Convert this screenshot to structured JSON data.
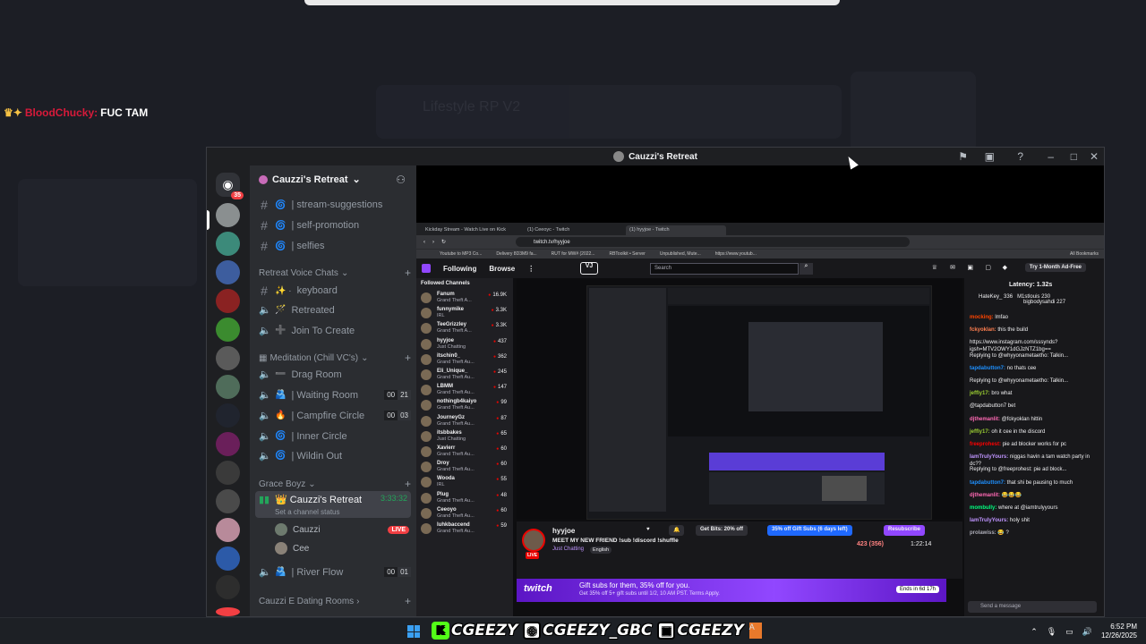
{
  "overlay": {
    "chat_user": "BloodChucky:",
    "chat_message": "FUC TAM"
  },
  "background": {
    "ghost_title": "Lifestyle RP V2"
  },
  "discord": {
    "window_title": "Cauzzi's Retreat",
    "server_badge": "35",
    "guild_name": "Cauzzi's Retreat",
    "text_channels": [
      "| stream-suggestions",
      "| self-promotion",
      "| selfies"
    ],
    "cat_retreat_voice": "Retreat Voice Chats",
    "voice_channels_1": [
      {
        "name": "keyboard",
        "prefix": "✨ ·"
      },
      {
        "name": "Retreated",
        "prefix": "🪄"
      },
      {
        "name": "Join To Create",
        "prefix": "➕"
      }
    ],
    "cat_meditation": "Meditation (Chill VC's)",
    "voice_channels_2": [
      {
        "name": "Drag Room",
        "prefix": "➖",
        "counts": []
      },
      {
        "name": "| Waiting Room",
        "prefix": "🫂",
        "counts": [
          "00",
          "21"
        ]
      },
      {
        "name": "| Campfire Circle",
        "prefix": "🔥",
        "counts": [
          "00",
          "03"
        ]
      },
      {
        "name": "| Inner Circle",
        "prefix": "🌀",
        "counts": []
      },
      {
        "name": "| Wildin Out",
        "prefix": "🌀",
        "counts": []
      }
    ],
    "cat_grace": "Grace Boyz",
    "active_channel": {
      "name": "Cauzzi's Retreat",
      "time": "3:33:32",
      "status": "Set a channel status"
    },
    "voice_users": [
      {
        "name": "Cauzzi",
        "live": "LIVE"
      },
      {
        "name": "Cee",
        "live": ""
      }
    ],
    "river_flow": {
      "name": "| River Flow",
      "counts": [
        "00",
        "01"
      ]
    },
    "cat_dating": "Cauzzi E Dating Rooms"
  },
  "browser": {
    "tabs": [
      "Kickday Stream - Watch Live on Kick",
      "(1) Ceeoyc - Twitch",
      "(1) hyyjoe - Twitch"
    ],
    "url": "twitch.tv/hyyjoe",
    "bookmarks": [
      "Youtube to MP3 Co...",
      "Delivery 8D3M9 fa...",
      "RUT for MW# (2022...",
      "RBToolkit • Server",
      "Unpublished, Mute...",
      "https://www.youtub..."
    ],
    "all_bookmarks": "All Bookmarks"
  },
  "twitch": {
    "nav_following": "Following",
    "nav_browse": "Browse",
    "search_placeholder": "Search",
    "turbo": "Try 1-Month Ad-Free",
    "side_header": "Followed Channels",
    "side_channels": [
      {
        "name": "Fanum",
        "game": "Grand Theft A...",
        "viewers": "16.9K"
      },
      {
        "name": "funnymike",
        "game": "IRL",
        "viewers": "3.3K"
      },
      {
        "name": "TeeGrizzley",
        "game": "Grand Theft A...",
        "viewers": "3.3K"
      },
      {
        "name": "hyyjoe",
        "game": "Just Chatting",
        "viewers": "437"
      },
      {
        "name": "itschin0_",
        "game": "Grand Theft Au...",
        "viewers": "362"
      },
      {
        "name": "Eli_Unique_",
        "game": "Grand Theft Au...",
        "viewers": "245"
      },
      {
        "name": "LBMM",
        "game": "Grand Theft Au...",
        "viewers": "147"
      },
      {
        "name": "nothingb4kaiyo",
        "game": "Grand Theft Au...",
        "viewers": "99"
      },
      {
        "name": "JourneyGz",
        "game": "Grand Theft Au...",
        "viewers": "87"
      },
      {
        "name": "itsbbakes",
        "game": "Just Chatting",
        "viewers": "65"
      },
      {
        "name": "Xavierr",
        "game": "Grand Theft Au...",
        "viewers": "60"
      },
      {
        "name": "Droy",
        "game": "Grand Theft Au...",
        "viewers": "60"
      },
      {
        "name": "Wooda",
        "game": "IRL",
        "viewers": "55"
      },
      {
        "name": "Plug",
        "game": "Grand Theft Au...",
        "viewers": "48"
      },
      {
        "name": "Ceeoyo",
        "game": "Grand Theft Au...",
        "viewers": "60"
      },
      {
        "name": "luhkbaccend",
        "game": "Grand Theft Au...",
        "viewers": "59"
      }
    ],
    "streamer": "hyyjoe",
    "stream_title": "MEET MY NEW FRIEND !sub !discord !shuffle",
    "stream_category": "Just Chatting",
    "stream_tag": "English",
    "get_bits": "Get Bits: 20% off",
    "gift_subs_btn": "35% off Gift Subs (6 days left)",
    "resubscribe": "Resubscribe",
    "viewers": "423 (356)",
    "uptime": "1:22:14",
    "banner_logo": "twitch",
    "banner_line1": "Gift subs for them, 35% off for you.",
    "banner_line2": "Get 35% off 5+ gift subs until 1/2, 10 AM PST. Terms Apply.",
    "banner_ends": "Ends in 6d 17h",
    "latency": "Latency: 1.32s",
    "chat_top": [
      {
        "name": "HateKey_",
        "count": "336"
      },
      {
        "name": "M1stlouis",
        "count": "230"
      },
      {
        "name": "bigbodysahdi",
        "count": "227"
      }
    ],
    "chat_lines": [
      {
        "user": "mocking:",
        "text": "lmfao",
        "color": "#ff4500"
      },
      {
        "user": "fckyoklan:",
        "text": "this the build",
        "color": "#ff7f50"
      },
      {
        "user": "",
        "text": "https://www.instagram.com/sssynds?igsh=MTV2OWY1dGJzNTZ1bg==",
        "color": "#bf94ff"
      },
      {
        "user": "",
        "text": "Replying to @whyyonametaetho: Talkin...",
        "color": "#adadb8"
      },
      {
        "user": "tapdabutton7:",
        "text": "no thats cee",
        "color": "#1e90ff"
      },
      {
        "user": "",
        "text": "Replying to @whyyonametaetho: Talkin...",
        "color": "#adadb8"
      },
      {
        "user": "jeffly17:",
        "text": "bro what",
        "color": "#9acd32"
      },
      {
        "user": "",
        "text": "@tapdabutton7 bet",
        "color": "#efeff1"
      },
      {
        "user": "djthemanlit:",
        "text": "@fckyoklan hittin",
        "color": "#ff69b4"
      },
      {
        "user": "jeffly17:",
        "text": "oh it cee in the discord",
        "color": "#9acd32"
      },
      {
        "user": "freeprohest:",
        "text": "pie ad blocker works for pc",
        "color": "#ff0000"
      },
      {
        "user": "IamTrulyYours:",
        "text": "niggas havin a tam watch party in dc??",
        "color": "#bf94ff"
      },
      {
        "user": "",
        "text": "Replying to @freeprohest: pie ad block...",
        "color": "#adadb8"
      },
      {
        "user": "tapdabutton7:",
        "text": "that shi be pausing to much",
        "color": "#1e90ff"
      },
      {
        "user": "djthemanlit:",
        "text": "😂😂😂",
        "color": "#ff69b4"
      },
      {
        "user": "mombully:",
        "text": "where at @iamtrulyyours",
        "color": "#00ff7f"
      },
      {
        "user": "IamTrulyYours:",
        "text": "holy shit",
        "color": "#bf94ff"
      },
      {
        "user": "prolawiss:",
        "text": "😂 ?",
        "color": "#adadb8"
      }
    ],
    "chat_placeholder": "Send a message"
  },
  "taskbar": {
    "socials": [
      {
        "icon": "kick-icon",
        "glyph": "K",
        "label": "CGEEZY"
      },
      {
        "icon": "instagram-icon",
        "glyph": "◎",
        "label": "CGEEZY_GBC"
      },
      {
        "icon": "twitch-icon",
        "glyph": "▣",
        "label": "CGEEZY"
      }
    ],
    "time": "6:52 PM",
    "date": "12/26/2025"
  }
}
